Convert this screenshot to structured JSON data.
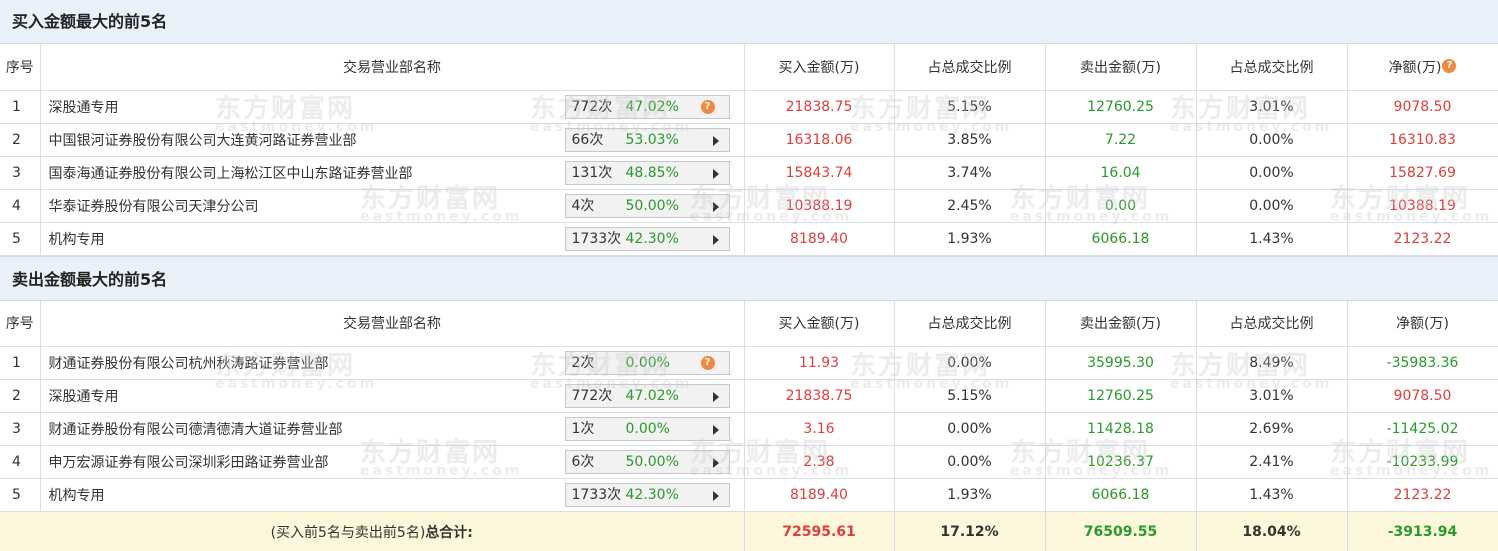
{
  "sections": [
    {
      "title": "买入金额最大的前5名",
      "headers": [
        "序号",
        "交易营业部名称",
        "买入金额(万)",
        "占总成交比例",
        "卖出金额(万)",
        "占总成交比例",
        "净额(万)"
      ],
      "rows": [
        {
          "idx": "1",
          "name": "深股通专用",
          "count": "772次",
          "pct": "47.02%",
          "stat_icon": "help",
          "buy": "21838.75",
          "buy_ratio": "5.15%",
          "sell": "12760.25",
          "sell_ratio": "3.01%",
          "net": "9078.50",
          "net_color": "red"
        },
        {
          "idx": "2",
          "name": "中国银河证券股份有限公司大连黄河路证券营业部",
          "count": "66次",
          "pct": "53.03%",
          "stat_icon": "arrow",
          "buy": "16318.06",
          "buy_ratio": "3.85%",
          "sell": "7.22",
          "sell_ratio": "0.00%",
          "net": "16310.83",
          "net_color": "red"
        },
        {
          "idx": "3",
          "name": "国泰海通证券股份有限公司上海松江区中山东路证券营业部",
          "count": "131次",
          "pct": "48.85%",
          "stat_icon": "arrow",
          "buy": "15843.74",
          "buy_ratio": "3.74%",
          "sell": "16.04",
          "sell_ratio": "0.00%",
          "net": "15827.69",
          "net_color": "red"
        },
        {
          "idx": "4",
          "name": "华泰证券股份有限公司天津分公司",
          "count": "4次",
          "pct": "50.00%",
          "stat_icon": "arrow",
          "buy": "10388.19",
          "buy_ratio": "2.45%",
          "sell": "0.00",
          "sell_ratio": "0.00%",
          "net": "10388.19",
          "net_color": "red"
        },
        {
          "idx": "5",
          "name": "机构专用",
          "count": "1733次",
          "pct": "42.30%",
          "stat_icon": "arrow",
          "buy": "8189.40",
          "buy_ratio": "1.93%",
          "sell": "6066.18",
          "sell_ratio": "1.43%",
          "net": "2123.22",
          "net_color": "red"
        }
      ]
    },
    {
      "title": "卖出金额最大的前5名",
      "headers": [
        "序号",
        "交易营业部名称",
        "买入金额(万)",
        "占总成交比例",
        "卖出金额(万)",
        "占总成交比例",
        "净额(万)"
      ],
      "rows": [
        {
          "idx": "1",
          "name": "财通证券股份有限公司杭州秋涛路证券营业部",
          "count": "2次",
          "pct": "0.00%",
          "stat_icon": "help",
          "buy": "11.93",
          "buy_ratio": "0.00%",
          "sell": "35995.30",
          "sell_ratio": "8.49%",
          "net": "-35983.36",
          "net_color": "green"
        },
        {
          "idx": "2",
          "name": "深股通专用",
          "count": "772次",
          "pct": "47.02%",
          "stat_icon": "arrow",
          "buy": "21838.75",
          "buy_ratio": "5.15%",
          "sell": "12760.25",
          "sell_ratio": "3.01%",
          "net": "9078.50",
          "net_color": "red"
        },
        {
          "idx": "3",
          "name": "财通证券股份有限公司德清德清大道证券营业部",
          "count": "1次",
          "pct": "0.00%",
          "stat_icon": "arrow",
          "buy": "3.16",
          "buy_ratio": "0.00%",
          "sell": "11428.18",
          "sell_ratio": "2.69%",
          "net": "-11425.02",
          "net_color": "green"
        },
        {
          "idx": "4",
          "name": "申万宏源证券有限公司深圳彩田路证券营业部",
          "count": "6次",
          "pct": "50.00%",
          "stat_icon": "arrow",
          "buy": "2.38",
          "buy_ratio": "0.00%",
          "sell": "10236.37",
          "sell_ratio": "2.41%",
          "net": "-10233.99",
          "net_color": "green"
        },
        {
          "idx": "5",
          "name": "机构专用",
          "count": "1733次",
          "pct": "42.30%",
          "stat_icon": "arrow",
          "buy": "8189.40",
          "buy_ratio": "1.93%",
          "sell": "6066.18",
          "sell_ratio": "1.43%",
          "net": "2123.22",
          "net_color": "red"
        }
      ]
    }
  ],
  "total": {
    "label_prefix": "(买入前5名与卖出前5名)",
    "label_bold": "总合计:",
    "buy": "72595.61",
    "buy_ratio": "17.12%",
    "sell": "76509.55",
    "sell_ratio": "18.04%",
    "net": "-3913.94"
  },
  "watermark": {
    "cn": "东方财富网",
    "en": "eastmoney.com"
  },
  "colors": {
    "up": "#e23c3c",
    "down": "#2a9a2a",
    "header_bg": "#e9f2fb",
    "total_bg": "#fdf8dc",
    "help_icon": "#f08a3c"
  },
  "icons": {
    "help": "question-help-icon",
    "arrow": "triangle-right-icon",
    "net_help": "question-help-icon"
  },
  "help_glyph": "?"
}
